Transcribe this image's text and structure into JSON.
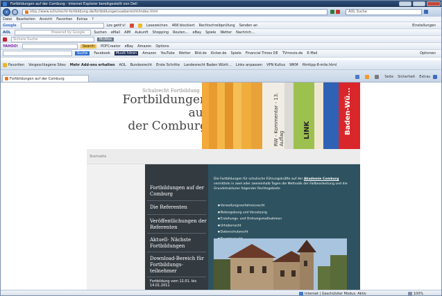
{
  "window": {
    "title": "Fortbildungen auf der Comburg - Internet Explorer bereitgestellt von Dell"
  },
  "nav": {
    "address": "http://www.schulrecht-fortbildung.de/fortbildungensuebersicht/index.html",
    "search_placeholder": "AOL Suche"
  },
  "menubar": [
    "Datei",
    "Bearbeiten",
    "Ansicht",
    "Favoriten",
    "Extras",
    "?"
  ],
  "toolbar_google": {
    "label": "Google",
    "items": [
      "Los geht's!",
      "Lesezeichen",
      "468 blockiert",
      "Rechtschreibprüfung",
      "Senden an"
    ],
    "settings": "Einstellungen"
  },
  "toolbar_aol": {
    "label": "AOL",
    "powered": "Powered by Google",
    "items": [
      "Suchen",
      "eMail",
      "AIM",
      "Aukunft",
      "Shopping",
      "Routen...",
      "eBay",
      "Spiele",
      "Wetter",
      "Nachrich..."
    ]
  },
  "toolbar_mcafee": {
    "placeholder": "Sichere Suche",
    "brand": "McAfee"
  },
  "toolbar_yahoo": {
    "brand": "YAHOO!",
    "search_label": "Search",
    "items": [
      "PDFCreator",
      "eBay",
      "Amazon",
      "Options"
    ]
  },
  "toolbar_links": {
    "search_label": "Suche",
    "items": [
      "Facebook",
      "Musik hören",
      "Amazon",
      "YouTube",
      "Wetter",
      "Bild.de",
      "Kicker.de",
      "Spiele",
      "Financial Times DE",
      "TVmovie.de",
      "E-Mail",
      "Optionen"
    ]
  },
  "favorites": {
    "label": "Favoriten",
    "items": [
      "Vorgeschlagene Sites",
      "Mehr Add-ons erhalten",
      "AOL",
      "Bundesrecht",
      "Erste Schritte",
      "Landesrecht Baden Württ...",
      "Links anpassen",
      "VPN Kultus",
      "WKM",
      "filmtipp-8-mile.html"
    ]
  },
  "tab": {
    "label": "Fortbildungen auf der Comburg"
  },
  "command_bar": [
    "Seite",
    "Sicherheit",
    "Extras"
  ],
  "site": {
    "subtitle": "Schulrecht Fortbildung",
    "title_line1": "Fortbildungen auf",
    "title_line2": "der Comburg",
    "breadcrumb": "Startseite",
    "nav_items": [
      "Fortbildungen auf der Comburg",
      "Die Referenten",
      "Veröffentlichungen der Referenten",
      "Aktuell- Nächste Fortbildungen",
      "Download-Bereich für Fortbildungs-teilnehmer",
      "Fortbildung vom 12.01. bis 14.01.2011"
    ],
    "intro_text": "Die Fortbildungen für schulische Führungskräfte auf der",
    "intro_link": "Akademie Comburg",
    "intro_rest": "vermitteln in zwei oder zweieinhalb Tagen die Methodik der Fallbearbeitung und die Grundstrukturen folgender Rechtsgebiete",
    "topics": [
      "Verwaltungsverfahrensrecht",
      "Notengebung und Versetzung",
      "Erziehungs- und Ordnungsmaßnahmen",
      "Urheberrecht",
      "Datenschutzrecht",
      "Beamtenrecht"
    ]
  },
  "status": {
    "zone": "Internet | Geschützter Modus: Aktiv",
    "zoom": "100%"
  },
  "book_spines": [
    "RW - Kommentar - 13. Auflag",
    "LINK",
    "Baden-Wü..."
  ]
}
